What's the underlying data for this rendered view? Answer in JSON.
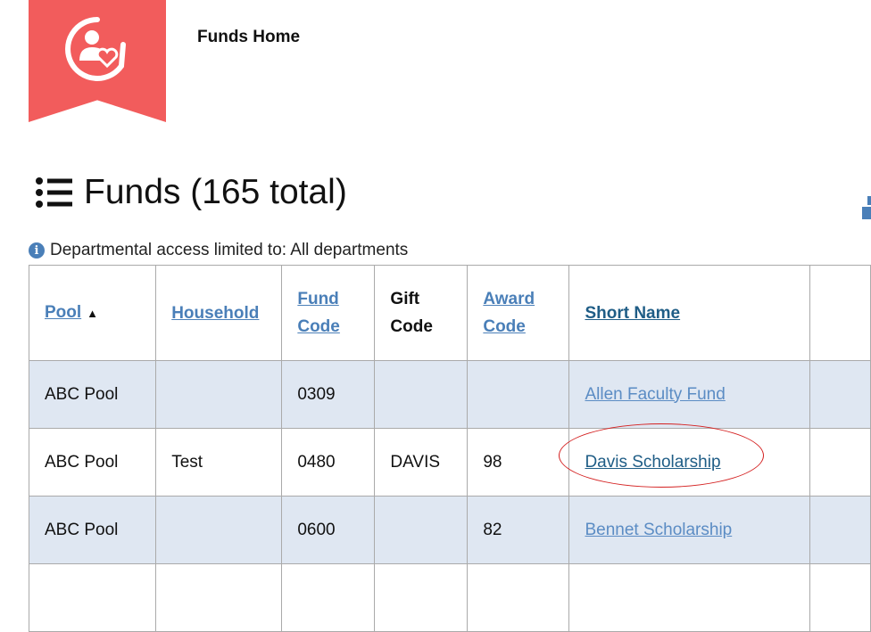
{
  "header": {
    "nav_home": "Funds Home",
    "logo_icon": "person-heart-icon",
    "brand_color": "#f25c5c"
  },
  "page": {
    "title": "Funds (165 total)",
    "title_icon": "list-icon",
    "access_note": "Departmental access limited to: All departments",
    "info_icon": "i"
  },
  "table": {
    "headers": {
      "pool": "Pool",
      "household": "Household",
      "fund_code": "Fund Code",
      "gift_code": "Gift Code",
      "award_code": "Award Code",
      "short_name": "Short Name"
    },
    "sort_indicator": "▲",
    "rows": [
      {
        "pool": "ABC Pool",
        "household": "",
        "fund_code": "0309",
        "gift_code": "",
        "award_code": "",
        "short_name": "Allen Faculty Fund"
      },
      {
        "pool": "ABC Pool",
        "household": "Test",
        "fund_code": "0480",
        "gift_code": "DAVIS",
        "award_code": "98",
        "short_name": "Davis Scholarship"
      },
      {
        "pool": "ABC Pool",
        "household": "",
        "fund_code": "0600",
        "gift_code": "",
        "award_code": "82",
        "short_name": "Bennet Scholarship"
      }
    ]
  },
  "colors": {
    "row_shade": "#dfe7f2",
    "link": "#5b8cc4",
    "link_active": "#1f5d86",
    "annotation": "#d42020"
  }
}
